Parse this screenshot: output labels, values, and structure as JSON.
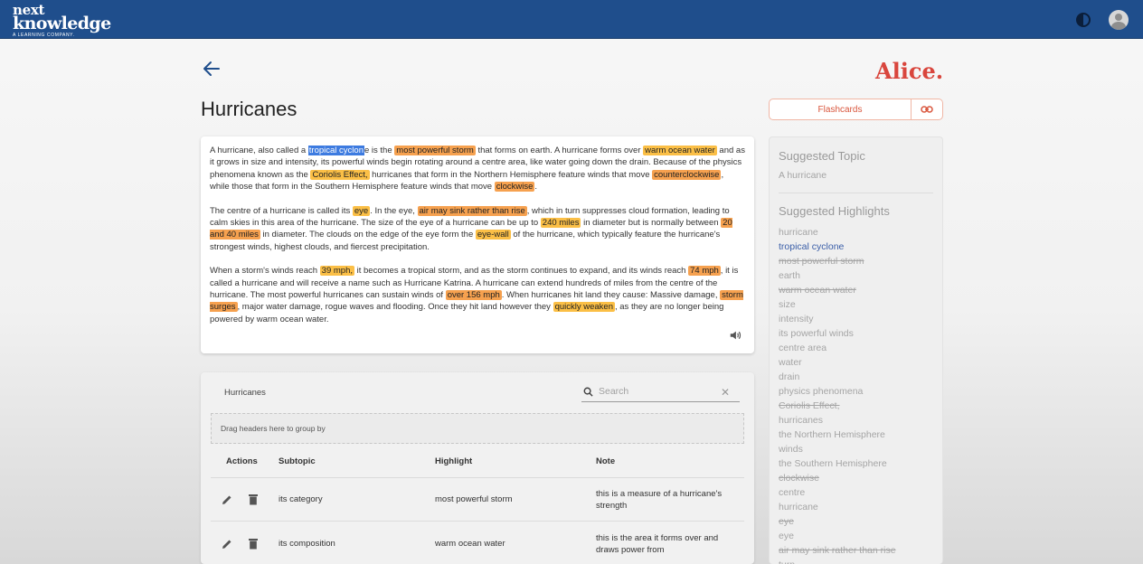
{
  "header": {
    "logo_line1": "next",
    "logo_line2": "knowledge",
    "logo_tagline": "A LEARNING COMPANY.",
    "theme_icon": "contrast-icon",
    "avatar_icon": "user-avatar-icon"
  },
  "page": {
    "title": "Hurricanes",
    "brand": "Alice.",
    "flashcards_label": "Flashcards"
  },
  "article": {
    "paragraphs": [
      [
        {
          "t": "A hurricane, also called a "
        },
        {
          "t": "tropical cyclon",
          "s": "sel"
        },
        {
          "t": "e is the "
        },
        {
          "t": "most powerful storm",
          "s": "hl"
        },
        {
          "t": " that forms on earth. A hurricane forms over "
        },
        {
          "t": "warm ocean water",
          "s": "hl2"
        },
        {
          "t": " and as it grows in size and intensity, its powerful winds begin rotating around a centre area, like water going down the drain. Because of the physics phenomena known as the "
        },
        {
          "t": "Coriolis Effect,",
          "s": "hl2"
        },
        {
          "t": " hurricanes that form in the Northern Hemisphere feature winds that move "
        },
        {
          "t": "counterclockwise",
          "s": "hl"
        },
        {
          "t": ", while those that form in the Southern Hemisphere feature winds that move "
        },
        {
          "t": "clockwise",
          "s": "hl"
        },
        {
          "t": "."
        }
      ],
      [
        {
          "t": "The centre of a hurricane is called its "
        },
        {
          "t": "eye",
          "s": "hl2"
        },
        {
          "t": ". In the eye, "
        },
        {
          "t": "air may sink rather than rise",
          "s": "hl"
        },
        {
          "t": ", which in turn suppresses cloud formation, leading to calm skies in this area of the hurricane. The size of the eye of a hurricane can be up to "
        },
        {
          "t": "240 miles",
          "s": "hl2"
        },
        {
          "t": " in diameter but is normally between "
        },
        {
          "t": "20 and 40 miles",
          "s": "hl"
        },
        {
          "t": " in diameter. The clouds on the edge of the eye form the "
        },
        {
          "t": "eye-wall",
          "s": "hl2"
        },
        {
          "t": " of the hurricane, which typically feature the hurricane's strongest winds, highest clouds, and fiercest precipitation."
        }
      ],
      [
        {
          "t": "When a storm's winds reach "
        },
        {
          "t": "39 mph,",
          "s": "hl2"
        },
        {
          "t": " it becomes a tropical storm, and as the storm continues to expand, and its winds reach "
        },
        {
          "t": "74 mph",
          "s": "hl"
        },
        {
          "t": ", it is called a hurricane and will receive a name such as Hurricane Katrina. A hurricane can extend hundreds of miles from the centre of the hurricane. The most powerful hurricanes can sustain winds of "
        },
        {
          "t": "over 156 mph",
          "s": "hl"
        },
        {
          "t": ". When hurricanes hit land they cause: Massive damage, "
        },
        {
          "t": "storm surges",
          "s": "hl"
        },
        {
          "t": ", major water damage, rogue waves and flooding. Once they hit land however they "
        },
        {
          "t": "quickly weaken",
          "s": "hl2"
        },
        {
          "t": ", as they are no longer being powered by warm ocean water."
        }
      ]
    ]
  },
  "side": {
    "topic_heading": "Suggested Topic",
    "topic": "A hurricane",
    "highlights_heading": "Suggested Highlights",
    "highlights": [
      {
        "label": "hurricane"
      },
      {
        "label": "tropical cyclone",
        "state": "active"
      },
      {
        "label": "most powerful storm",
        "state": "struck"
      },
      {
        "label": "earth"
      },
      {
        "label": "warm ocean water",
        "state": "struck"
      },
      {
        "label": "size"
      },
      {
        "label": "intensity"
      },
      {
        "label": "its powerful winds"
      },
      {
        "label": "centre area"
      },
      {
        "label": "water"
      },
      {
        "label": "drain"
      },
      {
        "label": "physics phenomena"
      },
      {
        "label": "Coriolis Effect,",
        "state": "struck"
      },
      {
        "label": "hurricanes"
      },
      {
        "label": "the Northern Hemisphere"
      },
      {
        "label": "winds"
      },
      {
        "label": "the Southern Hemisphere"
      },
      {
        "label": "clockwise",
        "state": "struck"
      },
      {
        "label": "centre"
      },
      {
        "label": "hurricane"
      },
      {
        "label": "eye",
        "state": "struck"
      },
      {
        "label": "eye"
      },
      {
        "label": "air may sink rather than rise",
        "state": "struck"
      },
      {
        "label": "turn"
      }
    ]
  },
  "grid": {
    "title": "Hurricanes",
    "search_placeholder": "Search",
    "group_hint": "Drag headers here to group by",
    "columns": {
      "actions": "Actions",
      "subtopic": "Subtopic",
      "highlight": "Highlight",
      "note": "Note"
    },
    "rows": [
      {
        "subtopic": "its category",
        "highlight": "most powerful storm",
        "note": "this is a measure of a hurricane's strength"
      },
      {
        "subtopic": "its composition",
        "highlight": "warm ocean water",
        "note": "this is the area it forms over and draws power from"
      }
    ]
  }
}
